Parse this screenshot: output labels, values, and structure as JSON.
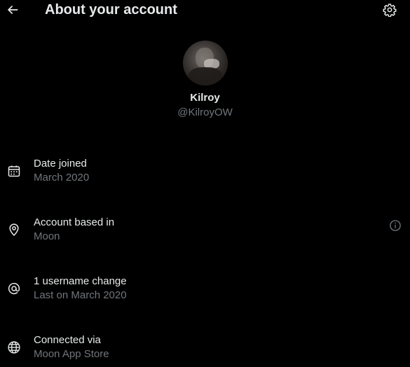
{
  "header": {
    "title": "About your account",
    "back_icon": "arrow-left-icon",
    "settings_icon": "gear-icon"
  },
  "profile": {
    "display_name": "Kilroy",
    "handle": "@KilroyOW"
  },
  "rows": [
    {
      "icon": "calendar-icon",
      "title": "Date joined",
      "value": "March 2020"
    },
    {
      "icon": "location-pin-icon",
      "title": "Account based in",
      "value": "Moon",
      "info_icon": "info-icon"
    },
    {
      "icon": "at-sign-icon",
      "title": "1 username change",
      "value": "Last on March 2020"
    },
    {
      "icon": "globe-icon",
      "title": "Connected via",
      "value": "Moon App Store"
    }
  ],
  "colors": {
    "background": "#000000",
    "primary_text": "#e7e9ea",
    "secondary_text": "#71767b"
  }
}
